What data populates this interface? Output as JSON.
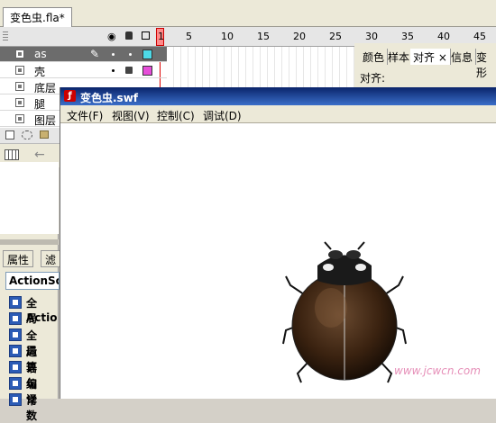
{
  "document_tab": {
    "label": "变色虫.fla*"
  },
  "timeline": {
    "frame_numbers": [
      "1",
      "5",
      "10",
      "15",
      "20",
      "25",
      "30",
      "35",
      "40",
      "45"
    ],
    "layers": [
      {
        "name": "as",
        "color": "#4dd9e6",
        "selected": true
      },
      {
        "name": "壳",
        "color": "#e64dd9",
        "selected": false
      },
      {
        "name": "底层",
        "color": null,
        "selected": false
      },
      {
        "name": "腿",
        "color": null,
        "selected": false
      },
      {
        "name": "图层",
        "color": null,
        "selected": false
      }
    ]
  },
  "properties_panel": {
    "tabs": [
      "属性",
      "滤"
    ],
    "combo_value": "ActionScr",
    "items": [
      "全局",
      "Actio",
      "全局",
      "运算",
      "语句",
      "编译",
      "常数"
    ]
  },
  "align_panel": {
    "tabs": [
      "颜色",
      "样本",
      "对齐",
      "信息",
      "变形"
    ],
    "title": "对齐:"
  },
  "swf_window": {
    "title": "变色虫.swf",
    "menu": [
      "文件(F)",
      "视图(V)",
      "控制(C)",
      "调试(D)"
    ]
  },
  "watermark": {
    "text": "www.jcwcn.com"
  },
  "colors": {
    "title_bar": "#0a246a",
    "selected_layer": "#6c6c6c",
    "playhead": "#ff8a8a"
  }
}
